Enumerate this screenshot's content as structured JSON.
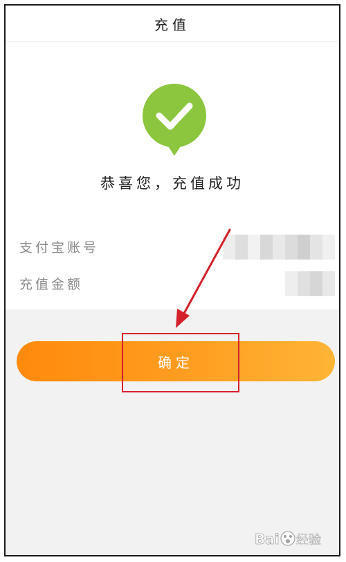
{
  "header": {
    "title": "充值"
  },
  "result": {
    "message": "恭喜您，充值成功",
    "icon": "check-icon",
    "icon_color": "#8cc63f"
  },
  "details": [
    {
      "label": "支付宝账号"
    },
    {
      "label": "充值金额"
    }
  ],
  "confirm": {
    "label": "确定"
  },
  "colors": {
    "accent_start": "#ff8a0c",
    "accent_end": "#ffb536",
    "annotation": "#d4212a",
    "background": "#f2f2f2"
  },
  "watermark": {
    "text": "Bai经验"
  }
}
